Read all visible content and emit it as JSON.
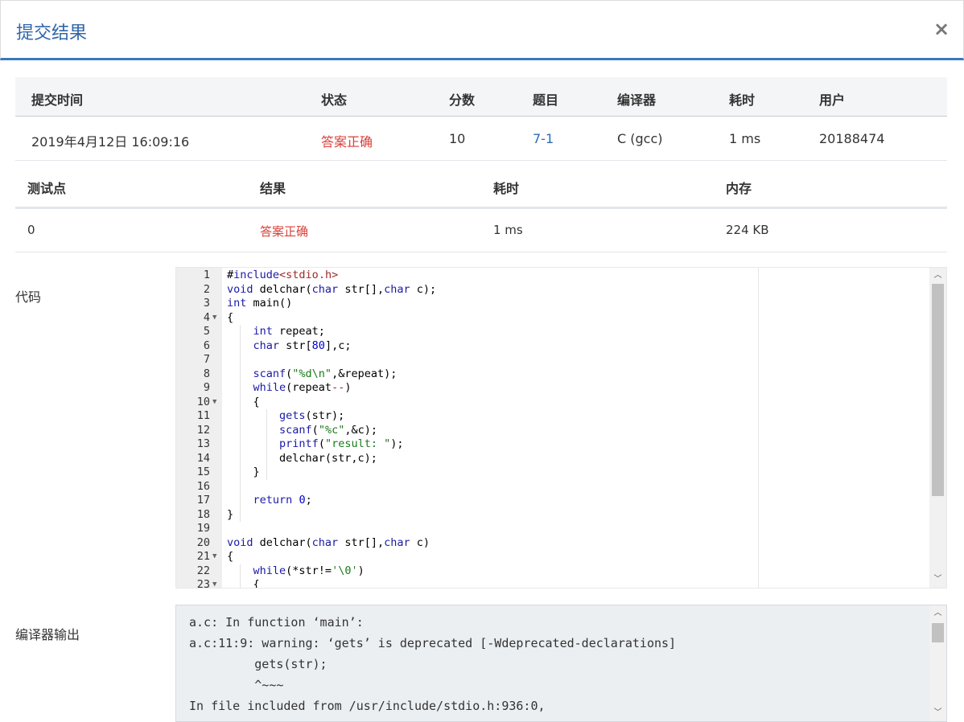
{
  "dialog": {
    "title": "提交结果",
    "close_label": "×"
  },
  "summary": {
    "headers": [
      "提交时间",
      "状态",
      "分数",
      "题目",
      "编译器",
      "耗时",
      "用户"
    ],
    "row": [
      "2019年4月12日 16:09:16",
      "答案正确",
      "10",
      "7-1",
      "C (gcc)",
      "1 ms",
      "20188474"
    ]
  },
  "cases": {
    "headers": [
      "测试点",
      "结果",
      "耗时",
      "内存"
    ],
    "row": [
      "0",
      "答案正确",
      "1 ms",
      "224 KB"
    ]
  },
  "code": {
    "label": "代码",
    "lines": [
      {
        "n": "1",
        "text": "#include<stdio.h>"
      },
      {
        "n": "2",
        "text": "void delchar(char str[],char c);"
      },
      {
        "n": "3",
        "text": "int main()"
      },
      {
        "n": "4",
        "text": "{"
      },
      {
        "n": "5",
        "text": "    int repeat;"
      },
      {
        "n": "6",
        "text": "    char str[80],c;"
      },
      {
        "n": "7",
        "text": ""
      },
      {
        "n": "8",
        "text": "    scanf(\"%d\\n\",&repeat);"
      },
      {
        "n": "9",
        "text": "    while(repeat--)"
      },
      {
        "n": "10",
        "text": "    {"
      },
      {
        "n": "11",
        "text": "        gets(str);"
      },
      {
        "n": "12",
        "text": "        scanf(\"%c\",&c);"
      },
      {
        "n": "13",
        "text": "        printf(\"result: \");"
      },
      {
        "n": "14",
        "text": "        delchar(str,c);"
      },
      {
        "n": "15",
        "text": "    }"
      },
      {
        "n": "16",
        "text": ""
      },
      {
        "n": "17",
        "text": "    return 0;"
      },
      {
        "n": "18",
        "text": "}"
      },
      {
        "n": "19",
        "text": ""
      },
      {
        "n": "20",
        "text": "void delchar(char str[],char c)"
      },
      {
        "n": "21",
        "text": "{"
      },
      {
        "n": "22",
        "text": "    while(*str!='\\0')"
      },
      {
        "n": "23",
        "text": "    {"
      }
    ],
    "fold_lines": [
      "4",
      "10",
      "21",
      "23"
    ]
  },
  "compiler_output": {
    "label": "编译器输出",
    "lines": [
      "a.c: In function ‘main’:",
      "a.c:11:9: warning: ‘gets’ is deprecated [-Wdeprecated-declarations]",
      "         gets(str);",
      "         ^~~~",
      "In file included from /usr/include/stdio.h:936:0,"
    ]
  }
}
